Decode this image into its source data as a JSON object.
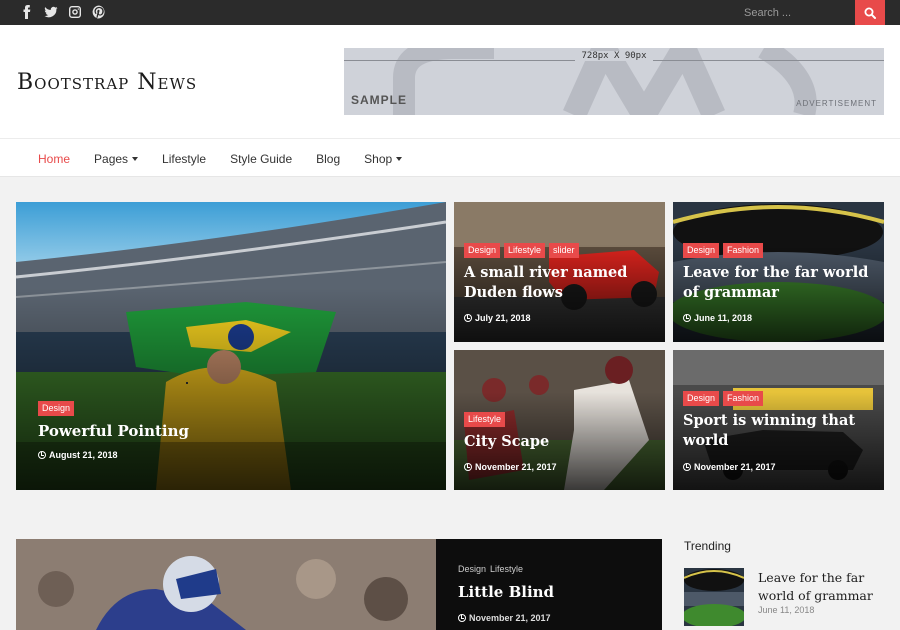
{
  "topbar": {
    "social_icons": [
      "facebook-icon",
      "twitter-icon",
      "instagram-icon",
      "pinterest-icon"
    ],
    "search_placeholder": "Search ...",
    "search_icon": "search-icon"
  },
  "header": {
    "logo": "Bootstrap News",
    "ad": {
      "size": "728px X 90px",
      "sample": "SAMPLE",
      "label": "ADVERTISEMENT"
    }
  },
  "nav": {
    "items": [
      {
        "label": "Home",
        "active": true
      },
      {
        "label": "Pages",
        "dropdown": true
      },
      {
        "label": "Lifestyle"
      },
      {
        "label": "Style Guide"
      },
      {
        "label": "Blog"
      },
      {
        "label": "Shop",
        "dropdown": true
      }
    ]
  },
  "featured": {
    "main": {
      "cats": [
        "Design"
      ],
      "title": "Powerful Pointing",
      "date": "August 21, 2018"
    },
    "cards": [
      {
        "cats": [
          "Design",
          "Lifestyle",
          "slider"
        ],
        "title": "A small river named Duden flows",
        "date": "July 21, 2018"
      },
      {
        "cats": [
          "Design",
          "Fashion"
        ],
        "title": "Leave for the far world of grammar",
        "date": "June 11, 2018"
      },
      {
        "cats": [
          "Lifestyle"
        ],
        "title": "City Scape",
        "date": "November 21, 2017"
      },
      {
        "cats": [
          "Design",
          "Fashion"
        ],
        "title": "Sport is winning that world",
        "date": "November 21, 2017"
      }
    ]
  },
  "latest": {
    "cats": [
      "Design",
      "Lifestyle"
    ],
    "title": "Little Blind",
    "date": "November 21, 2017"
  },
  "trending": {
    "heading": "Trending",
    "item": {
      "title": "Leave for the far world of grammar",
      "date": "June 11, 2018"
    }
  },
  "colors": {
    "accent": "#e84a4a",
    "topbar": "#2b2b2b"
  }
}
